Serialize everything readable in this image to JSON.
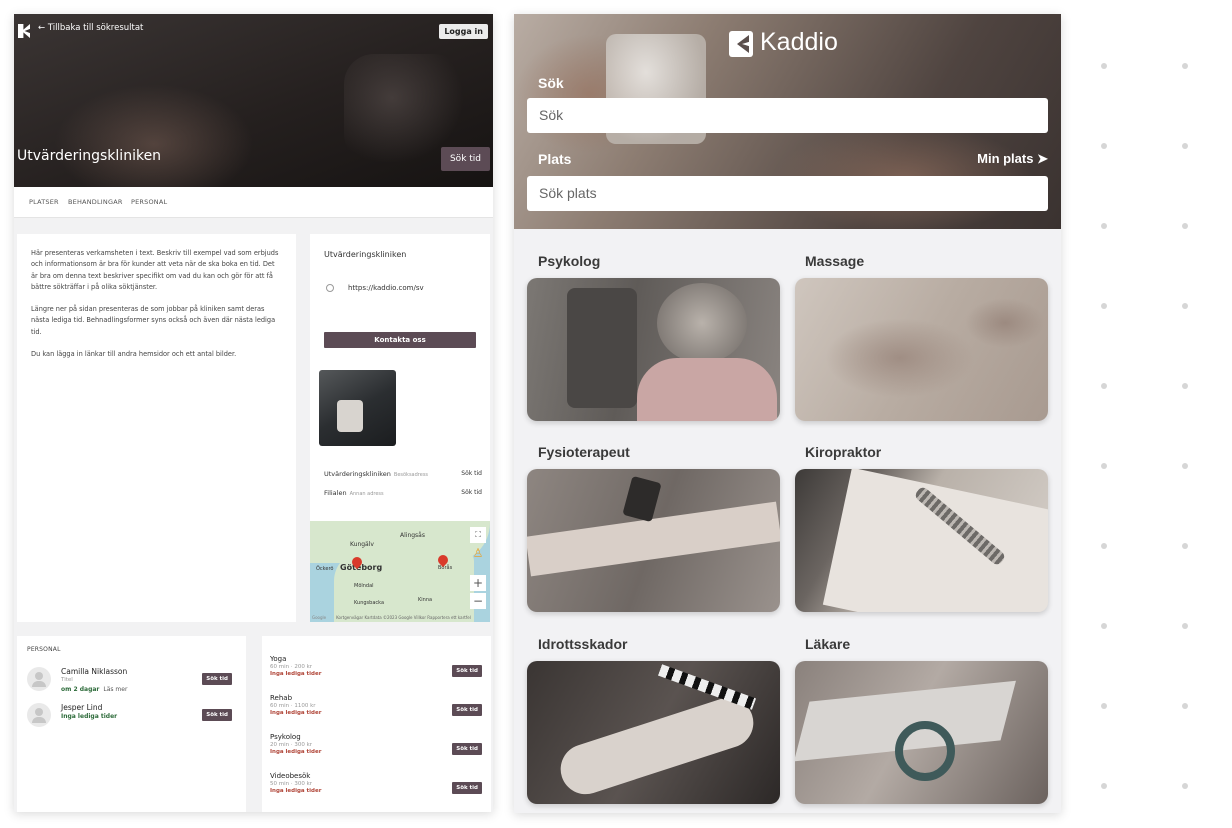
{
  "clinic_page": {
    "back_link": "← Tillbaka till sökresultat",
    "login": "Logga in",
    "title": "Utvärderingskliniken",
    "book": "Sök tid",
    "tabs": [
      "PLATSER",
      "BEHANDLINGAR",
      "PERSONAL"
    ],
    "description": [
      "Här presenteras verkamsheten i text. Beskriv till exempel vad som erbjuds och informationsom är bra för kunder att veta när de ska boka en tid. Det är bra om denna text beskriver specifikt om vad du kan och gör för att få bättre sökträffar i på olika söktjänster.",
      "Längre ner på sidan presenteras de som jobbar på kliniken samt deras nästa lediga tid. Behnadlingsformer syns också och även där nästa lediga tid.",
      "Du kan lägga in länkar till andra hemsidor och ett antal bilder."
    ],
    "info": {
      "name": "Utvärderingskliniken",
      "url": "https://kaddio.com/sv",
      "contact": "Kontakta oss"
    },
    "locations": [
      {
        "name": "Utvärderingskliniken",
        "address": "Besöksadress",
        "action": "Sök tid"
      },
      {
        "name": "Filialen",
        "address": "Annan adress",
        "action": "Sök tid"
      }
    ],
    "map": {
      "labels": [
        "Kungälv",
        "Alingsås",
        "Öckerö",
        "Göteborg",
        "Borås",
        "Mölndal",
        "Kungsbacka",
        "Kinna"
      ],
      "footer": "Kortgenvägar  Kartdata ©2023 Google  Villkor  Rapportera ett kartfel",
      "zoom_in": "+",
      "zoom_out": "−",
      "brand": "Google"
    },
    "staff": {
      "header": "PERSONAL",
      "people": [
        {
          "name": "Camilla Niklasson",
          "title": "Titel",
          "availability": "om 2 dagar",
          "more": "Läs mer",
          "action": "Sök tid"
        },
        {
          "name": "Jesper Lind",
          "availability": "Inga lediga tider",
          "action": "Sök tid"
        }
      ]
    },
    "treatments": [
      {
        "name": "Yoga",
        "detail": "60 min · 200 kr",
        "availability": "Inga lediga tider",
        "action": "Sök tid"
      },
      {
        "name": "Rehab",
        "detail": "60 min · 1100 kr",
        "availability": "Inga lediga tider",
        "action": "Sök tid"
      },
      {
        "name": "Psykolog",
        "detail": "20 min · 300 kr",
        "availability": "Inga lediga tider",
        "action": "Sök tid"
      },
      {
        "name": "Videobesök",
        "detail": "50 min · 300 kr",
        "availability": "Inga lediga tider",
        "action": "Sök tid"
      }
    ]
  },
  "app": {
    "brand": "Kaddio",
    "search_label": "Sök",
    "search_placeholder": "Sök",
    "place_label": "Plats",
    "my_location": "Min plats",
    "place_placeholder": "Sök plats",
    "categories": [
      "Psykolog",
      "Massage",
      "Fysioterapeut",
      "Kiropraktor",
      "Idrottsskador",
      "Läkare"
    ]
  }
}
